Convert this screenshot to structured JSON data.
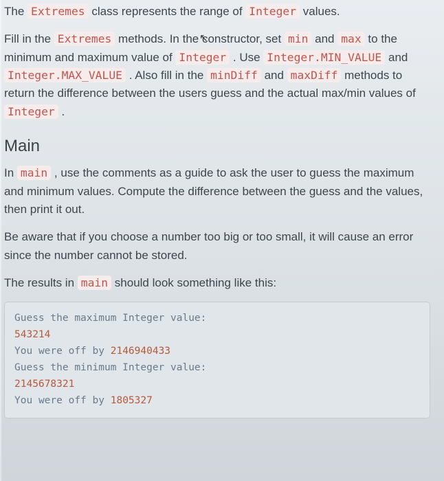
{
  "intro": {
    "p1_a": "The ",
    "p1_code_extremes": "Extremes",
    "p1_b": " class represents the range of ",
    "p1_code_integer": "Integer",
    "p1_c": " values.",
    "p2_a": "Fill in the ",
    "p2_code_extremes": "Extremes",
    "p2_b": " methods. In the constructor, set ",
    "p2_code_min": "min",
    "p2_c": " and ",
    "p2_code_max": "max",
    "p2_d": " to the minimum and maximum value of ",
    "p2_code_integer": "Integer",
    "p2_e": " . Use ",
    "p2_code_minval": "Integer.MIN_VALUE",
    "p2_f": " and ",
    "p2_code_maxval": "Integer.MAX_VALUE",
    "p2_g": " . Also fill in the ",
    "p2_code_mindiff": "minDiff",
    "p2_h": " and ",
    "p2_code_maxdiff": "maxDiff",
    "p2_i": " methods to return the difference between the users guess and the actual max/min values of ",
    "p2_code_integer2": "Integer",
    "p2_j": " ."
  },
  "main_section": {
    "heading": "Main",
    "p1_a": "In ",
    "p1_code_main": "main",
    "p1_b": " , use the comments as a guide to ask the user to guess the maximum and minimum values. Compute the difference between the guess and the values, then print it out.",
    "p2": "Be aware that if you choose a number too big or too small, it will cause an error since the number cannot be stored.",
    "p3_a": "The results in ",
    "p3_code_main": "main",
    "p3_b": " should look something like this:"
  },
  "output": {
    "l1_guess": "Guess",
    "l1_the": "the",
    "l1_max": "maximum",
    "l1_integer": "Integer",
    "l1_value": "value:",
    "l2_num": "543214",
    "l3_you": "You",
    "l3_were": "were",
    "l3_off": "off",
    "l3_by": "by",
    "l3_num": "2146940433",
    "l4_guess": "Guess",
    "l4_the": "the",
    "l4_min": "minimum",
    "l4_integer": "Integer",
    "l4_value": "value:",
    "l5_num": "2145678321",
    "l6_you": "You",
    "l6_were": "were",
    "l6_off": "off",
    "l6_by": "by",
    "l6_num": "1805327"
  }
}
